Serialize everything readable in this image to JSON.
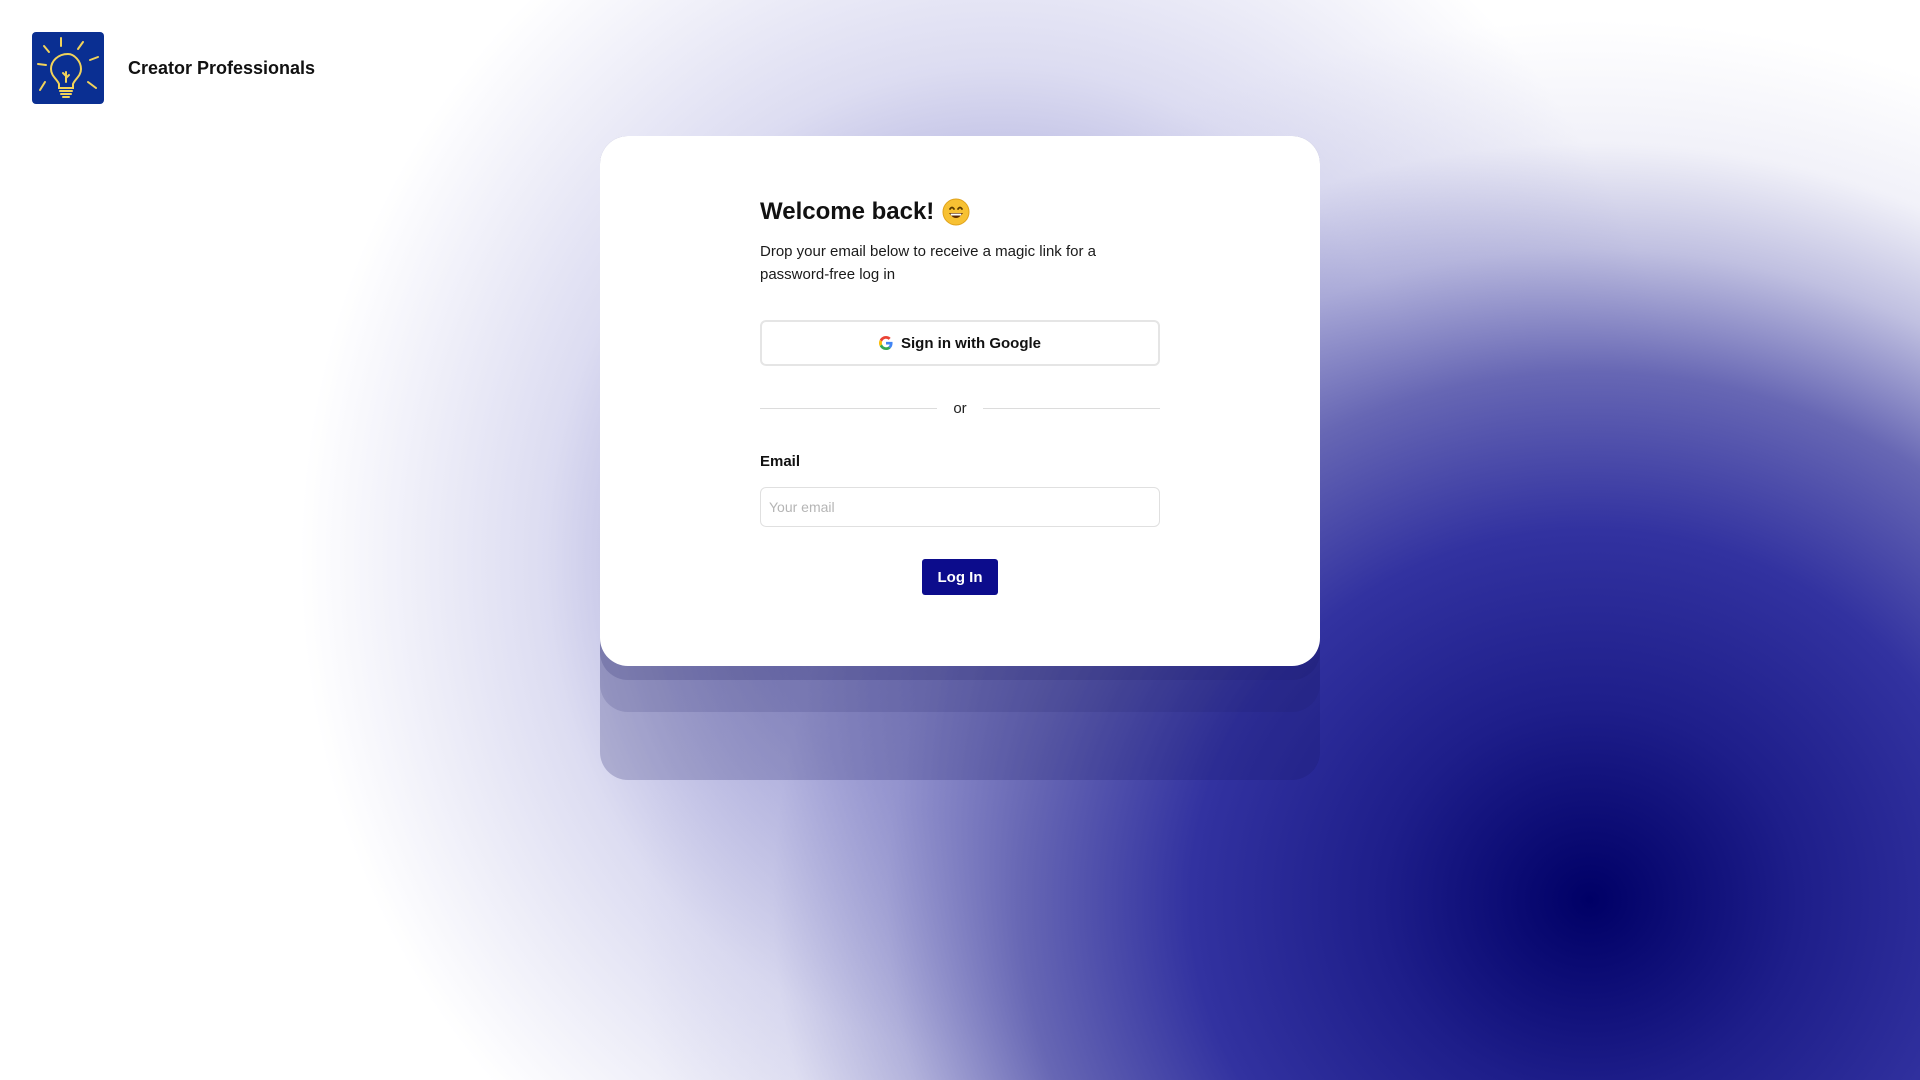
{
  "brand": {
    "name": "Creator Professionals",
    "logo_icon": "lightbulb-icon",
    "logo_bg_color": "#0a2f92",
    "logo_fg_color": "#f2d35a"
  },
  "login": {
    "title": "Welcome back!",
    "title_emoji": "grinning-face-emoji",
    "subtitle": "Drop your email below to receive a magic link for a password-free log in",
    "google_button_label": "Sign in with Google",
    "divider_text": "or",
    "email_label": "Email",
    "email_placeholder": "Your email",
    "email_value": "",
    "submit_label": "Log In"
  },
  "colors": {
    "accent": "#0c0c8c",
    "background_glow": "#000066"
  }
}
